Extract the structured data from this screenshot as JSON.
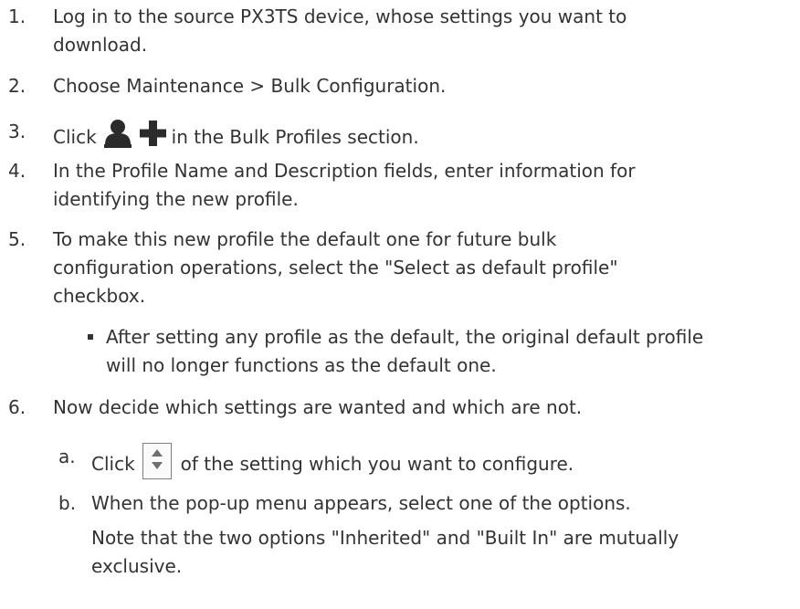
{
  "steps": {
    "s1": {
      "num": "1.",
      "line1": "Log in to the source PX3TS device, whose settings you want to",
      "line2": "download."
    },
    "s2": {
      "num": "2.",
      "text": "Choose Maintenance > Bulk Configuration."
    },
    "s3": {
      "num": "3.",
      "before": "Click",
      "after": "in the Bulk Profiles section.",
      "icon": "user-add-icon"
    },
    "s4": {
      "num": "4.",
      "line1": "In the Profile Name and Description fields, enter information for",
      "line2": "identifying the new profile."
    },
    "s5": {
      "num": "5.",
      "line1": "To make this new profile the default one for future bulk",
      "line2": "configuration operations, select the \"Select as default profile\"",
      "line3": "checkbox.",
      "bullet": {
        "line1": "After setting any profile as the default, the original default profile",
        "line2": "will no longer functions as the default one."
      }
    },
    "s6": {
      "num": "6.",
      "text": "Now decide which settings are wanted and which are not.",
      "a": {
        "num": "a.",
        "before": "Click",
        "after": "of the setting which you want to configure.",
        "icon": "up-down-arrows-icon"
      },
      "b": {
        "num": "b.",
        "text": "When the pop-up menu appears, select one of the options.",
        "note1": "Note that the two options \"Inherited\" and \"Built In\" are mutually",
        "note2": "exclusive."
      }
    }
  },
  "colors": {
    "text": "#333333",
    "icon": "#2b2b2b",
    "icon_border": "#7f7f7f"
  }
}
